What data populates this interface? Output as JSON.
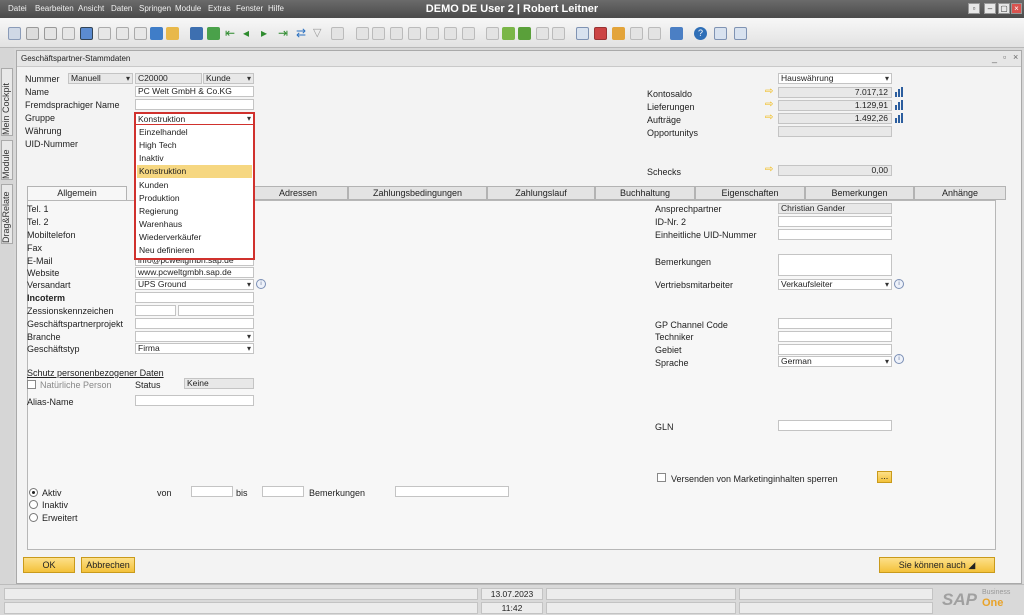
{
  "window": {
    "title": "DEMO DE User 2 | Robert Leitner",
    "menu": [
      "Datei",
      "Bearbeiten",
      "Ansicht",
      "Daten",
      "Springen",
      "Module",
      "Extras",
      "Fenster",
      "Hilfe"
    ]
  },
  "side_tabs": [
    "Mein Cockpit",
    "Module",
    "Drag&Relate"
  ],
  "form": {
    "title": "Geschäftspartner-Stammdaten",
    "header": {
      "nummer_label": "Nummer",
      "nummer_mode": "Manuell",
      "nummer_value": "C20000",
      "type_value": "Kunde",
      "name_label": "Name",
      "name_value": "PC Welt GmbH & Co.KG",
      "fremd_label": "Fremdsprachiger Name",
      "gruppe_label": "Gruppe",
      "gruppe_value": "Konstruktion",
      "waehrung_label": "Währung",
      "uid_label": "UID-Nummer"
    },
    "right_header": {
      "currency_value": "Hauswährung",
      "kontosaldo_label": "Kontosaldo",
      "kontosaldo_value": "7.017,12",
      "lieferungen_label": "Lieferungen",
      "lieferungen_value": "1.129,91",
      "auftraege_label": "Aufträge",
      "auftraege_value": "1.492,26",
      "opportunitys_label": "Opportunitys",
      "schecks_label": "Schecks",
      "schecks_value": "0,00"
    },
    "gruppe_dropdown": {
      "items": [
        "Einzelhandel",
        "High Tech",
        "Inaktiv",
        "Konstruktion",
        "Kunden",
        "Produktion",
        "Regierung",
        "Warenhaus",
        "Wiederverkäufer",
        "Neu definieren"
      ],
      "selected": "Konstruktion"
    },
    "tabs": [
      "Allgemein",
      "Adressen",
      "Zahlungsbedingungen",
      "Zahlungslauf",
      "Buchhaltung",
      "Eigenschaften",
      "Bemerkungen",
      "Anhänge"
    ],
    "general_left": {
      "tel1": "Tel. 1",
      "tel2": "Tel. 2",
      "mobil": "Mobiltelefon",
      "fax": "Fax",
      "email": "E-Mail",
      "email_value": "info@pcweltgmbh.sap.de",
      "website": "Website",
      "website_value": "www.pcweltgmbh.sap.de",
      "versandart": "Versandart",
      "versandart_value": "UPS Ground",
      "incoterm": "Incoterm",
      "zession": "Zessionskennzeichen",
      "gpprojekt": "Geschäftspartnerprojekt",
      "branche": "Branche",
      "geschaeftstyp": "Geschäftstyp",
      "geschaeftstyp_value": "Firma",
      "schutz": "Schutz personenbezogener Daten",
      "natuerliche_person": "Natürliche Person",
      "status_label": "Status",
      "status_value": "Keine",
      "alias": "Alias-Name"
    },
    "general_right": {
      "ansprechpartner": "Ansprechpartner",
      "ansprechpartner_value": "Christian Gander",
      "idnr2": "ID-Nr. 2",
      "einheitliche_uid": "Einheitliche UID-Nummer",
      "bemerkungen": "Bemerkungen",
      "vertrieb": "Vertriebsmitarbeiter",
      "vertrieb_value": "Verkaufsleiter",
      "gp_channel": "GP Channel Code",
      "techniker": "Techniker",
      "gebiet": "Gebiet",
      "sprache": "Sprache",
      "sprache_value": "German",
      "gln": "GLN",
      "marketing": "Versenden von Marketinginhalten sperren",
      "ellipsis": "..."
    },
    "status_block": {
      "aktiv": "Aktiv",
      "inaktiv": "Inaktiv",
      "erweitert": "Erweitert",
      "von": "von",
      "bis": "bis",
      "bemerkungen": "Bemerkungen"
    },
    "buttons": {
      "ok": "OK",
      "cancel": "Abbrechen",
      "also": "Sie können auch"
    }
  },
  "statusbar": {
    "date": "13.07.2023",
    "time": "11:42",
    "logo": "SAP",
    "logo_sub1": "Business",
    "logo_sub2": "One"
  },
  "colors": {
    "highlight_border": "#d0312d",
    "selected_item": "#f6d781",
    "button_gold": "#f3c13a"
  }
}
